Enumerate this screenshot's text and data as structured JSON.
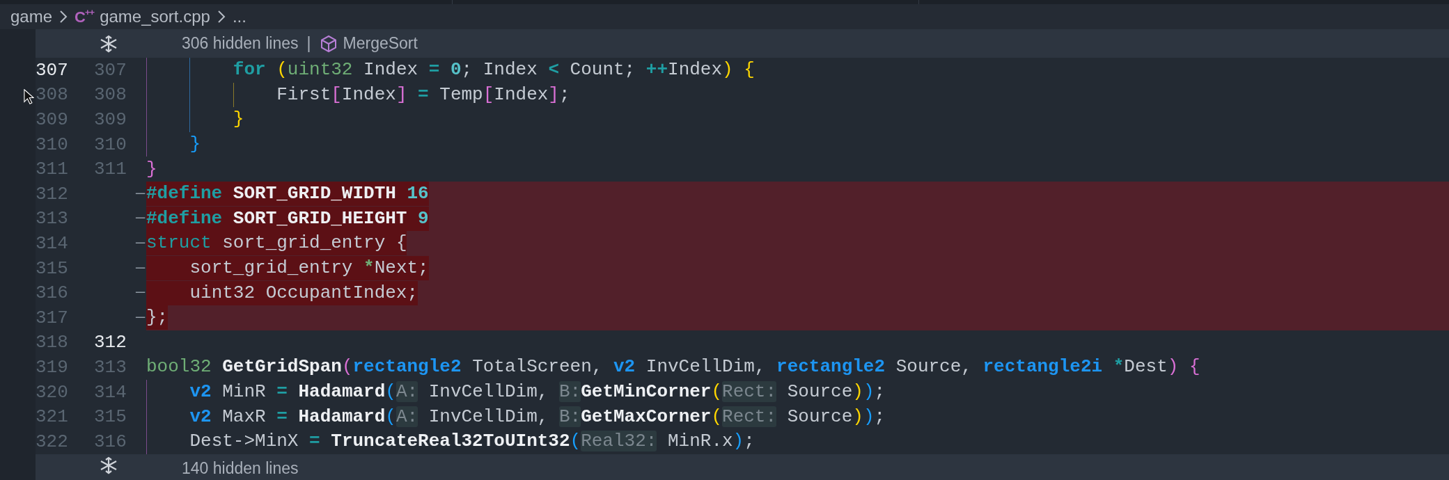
{
  "breadcrumb": {
    "items": [
      {
        "kind": "folder",
        "text": "game"
      },
      {
        "kind": "file",
        "icon_text": "C++",
        "text": "game_sort.cpp"
      },
      {
        "kind": "more",
        "text": "..."
      }
    ]
  },
  "top_fold": {
    "text": "306 hidden lines",
    "separator": "|",
    "symbol": "MergeSort"
  },
  "lines": [
    {
      "old": "307",
      "new": "307",
      "old_active": true,
      "new_active": false,
      "kind": "context",
      "tokens": [
        {
          "kind": "kw",
          "text": "        for"
        },
        {
          "kind": "b1",
          "text": " ("
        },
        {
          "kind": "type",
          "text": "uint32"
        },
        {
          "kind": "plain",
          "text": " Index "
        },
        {
          "kind": "op",
          "text": "="
        },
        {
          "kind": "num",
          "text": " 0"
        },
        {
          "kind": "plain",
          "text": "; Index "
        },
        {
          "kind": "op",
          "text": "<"
        },
        {
          "kind": "plain",
          "text": " Count; "
        },
        {
          "kind": "op",
          "text": "++"
        },
        {
          "kind": "plain",
          "text": "Index"
        },
        {
          "kind": "b1",
          "text": ")"
        },
        {
          "kind": "b1",
          "text": " {"
        }
      ]
    },
    {
      "old": "308",
      "new": "308",
      "old_active": false,
      "new_active": false,
      "kind": "context",
      "tokens": [
        {
          "kind": "plain",
          "text": "            First"
        },
        {
          "kind": "b2",
          "text": "["
        },
        {
          "kind": "plain",
          "text": "Index"
        },
        {
          "kind": "b2",
          "text": "]"
        },
        {
          "kind": "op",
          "text": " ="
        },
        {
          "kind": "plain",
          "text": " Temp"
        },
        {
          "kind": "b2",
          "text": "["
        },
        {
          "kind": "plain",
          "text": "Index"
        },
        {
          "kind": "b2",
          "text": "]"
        },
        {
          "kind": "plain",
          "text": ";"
        }
      ]
    },
    {
      "old": "309",
      "new": "309",
      "old_active": false,
      "new_active": false,
      "kind": "context",
      "tokens": [
        {
          "kind": "b1",
          "text": "        }"
        }
      ]
    },
    {
      "old": "310",
      "new": "310",
      "old_active": false,
      "new_active": false,
      "kind": "context",
      "tokens": [
        {
          "kind": "b3",
          "text": "    }"
        }
      ]
    },
    {
      "old": "311",
      "new": "311",
      "old_active": false,
      "new_active": false,
      "kind": "context",
      "tokens": [
        {
          "kind": "b2",
          "text": "}"
        }
      ]
    },
    {
      "old": "312",
      "kind": "deleted",
      "old_active": false,
      "marker": "—",
      "tokens": [
        {
          "kind": "kw",
          "text": "#define"
        },
        {
          "kind": "macro",
          "text": " SORT_GRID_WIDTH"
        },
        {
          "kind": "num",
          "text": " 16"
        }
      ]
    },
    {
      "old": "313",
      "kind": "deleted",
      "old_active": false,
      "marker": "—",
      "tokens": [
        {
          "kind": "kw",
          "text": "#define"
        },
        {
          "kind": "macro",
          "text": " SORT_GRID_HEIGHT"
        },
        {
          "kind": "num",
          "text": " 9"
        }
      ]
    },
    {
      "old": "314",
      "kind": "deleted",
      "old_active": false,
      "marker": "—",
      "tokens": [
        {
          "kind": "kwl",
          "text": "struct"
        },
        {
          "kind": "plain",
          "text": " sort_grid_entry {"
        }
      ]
    },
    {
      "old": "315",
      "kind": "deleted",
      "old_active": false,
      "marker": "—",
      "tokens": [
        {
          "kind": "plain",
          "text": "    sort_grid_entry "
        },
        {
          "kind": "ptr",
          "text": "*"
        },
        {
          "kind": "plain",
          "text": "Next;"
        }
      ]
    },
    {
      "old": "316",
      "kind": "deleted",
      "old_active": false,
      "marker": "—",
      "tokens": [
        {
          "kind": "plain",
          "text": "    uint32 OccupantIndex;"
        }
      ]
    },
    {
      "old": "317",
      "kind": "deleted",
      "old_active": false,
      "marker": "—",
      "tokens": [
        {
          "kind": "plain",
          "text": "};"
        }
      ]
    },
    {
      "old": "318",
      "new": "312",
      "old_active": false,
      "new_active": true,
      "kind": "context"
    },
    {
      "old": "319",
      "new": "313",
      "old_active": false,
      "new_active": false,
      "kind": "context",
      "tokens": [
        {
          "kind": "type",
          "text": "bool32"
        },
        {
          "kind": "func",
          "text": " GetGridSpan"
        },
        {
          "kind": "b2",
          "text": "("
        },
        {
          "kind": "vtype",
          "text": "rectangle2"
        },
        {
          "kind": "plain",
          "text": " TotalScreen, "
        },
        {
          "kind": "vtype",
          "text": "v2"
        },
        {
          "kind": "plain",
          "text": " InvCellDim, "
        },
        {
          "kind": "vtype",
          "text": "rectangle2"
        },
        {
          "kind": "plain",
          "text": " Source, "
        },
        {
          "kind": "vtype",
          "text": "rectangle2i"
        },
        {
          "kind": "op",
          "text": " *"
        },
        {
          "kind": "plain",
          "text": "Dest"
        },
        {
          "kind": "b2",
          "text": ")"
        },
        {
          "kind": "b2",
          "text": " {"
        }
      ]
    },
    {
      "old": "320",
      "new": "314",
      "old_active": false,
      "new_active": false,
      "kind": "context",
      "tokens": [
        {
          "kind": "vtype",
          "text": "    v2"
        },
        {
          "kind": "plain",
          "text": " MinR "
        },
        {
          "kind": "op",
          "text": "="
        },
        {
          "kind": "func",
          "text": " Hadamard"
        },
        {
          "kind": "b3",
          "text": "("
        },
        {
          "kind": "hint",
          "text": "A:"
        },
        {
          "kind": "plain",
          "text": " InvCellDim, "
        },
        {
          "kind": "hint",
          "text": "B:"
        },
        {
          "kind": "func",
          "text": "GetMinCorner"
        },
        {
          "kind": "b1",
          "text": "("
        },
        {
          "kind": "hint",
          "text": "Rect:"
        },
        {
          "kind": "plain",
          "text": " Source"
        },
        {
          "kind": "b1",
          "text": ")"
        },
        {
          "kind": "b3",
          "text": ")"
        },
        {
          "kind": "plain",
          "text": ";"
        }
      ]
    },
    {
      "old": "321",
      "new": "315",
      "old_active": false,
      "new_active": false,
      "kind": "context",
      "tokens": [
        {
          "kind": "vtype",
          "text": "    v2"
        },
        {
          "kind": "plain",
          "text": " MaxR "
        },
        {
          "kind": "op",
          "text": "="
        },
        {
          "kind": "func",
          "text": " Hadamard"
        },
        {
          "kind": "b3",
          "text": "("
        },
        {
          "kind": "hint",
          "text": "A:"
        },
        {
          "kind": "plain",
          "text": " InvCellDim, "
        },
        {
          "kind": "hint",
          "text": "B:"
        },
        {
          "kind": "func",
          "text": "GetMaxCorner"
        },
        {
          "kind": "b1",
          "text": "("
        },
        {
          "kind": "hint",
          "text": "Rect:"
        },
        {
          "kind": "plain",
          "text": " Source"
        },
        {
          "kind": "b1",
          "text": ")"
        },
        {
          "kind": "b3",
          "text": ")"
        },
        {
          "kind": "plain",
          "text": ";"
        }
      ]
    },
    {
      "old": "322",
      "new": "316",
      "old_active": false,
      "new_active": false,
      "kind": "context",
      "tokens": [
        {
          "kind": "plain",
          "text": "    Dest->MinX "
        },
        {
          "kind": "op",
          "text": "="
        },
        {
          "kind": "func",
          "text": " TruncateReal32ToUInt32"
        },
        {
          "kind": "b3",
          "text": "("
        },
        {
          "kind": "hint",
          "text": "Real32:"
        },
        {
          "kind": "plain",
          "text": " MinR.x"
        },
        {
          "kind": "b3",
          "text": ")"
        },
        {
          "kind": "plain",
          "text": ";"
        }
      ]
    }
  ],
  "bottom_fold": {
    "text": "140 hidden lines"
  }
}
